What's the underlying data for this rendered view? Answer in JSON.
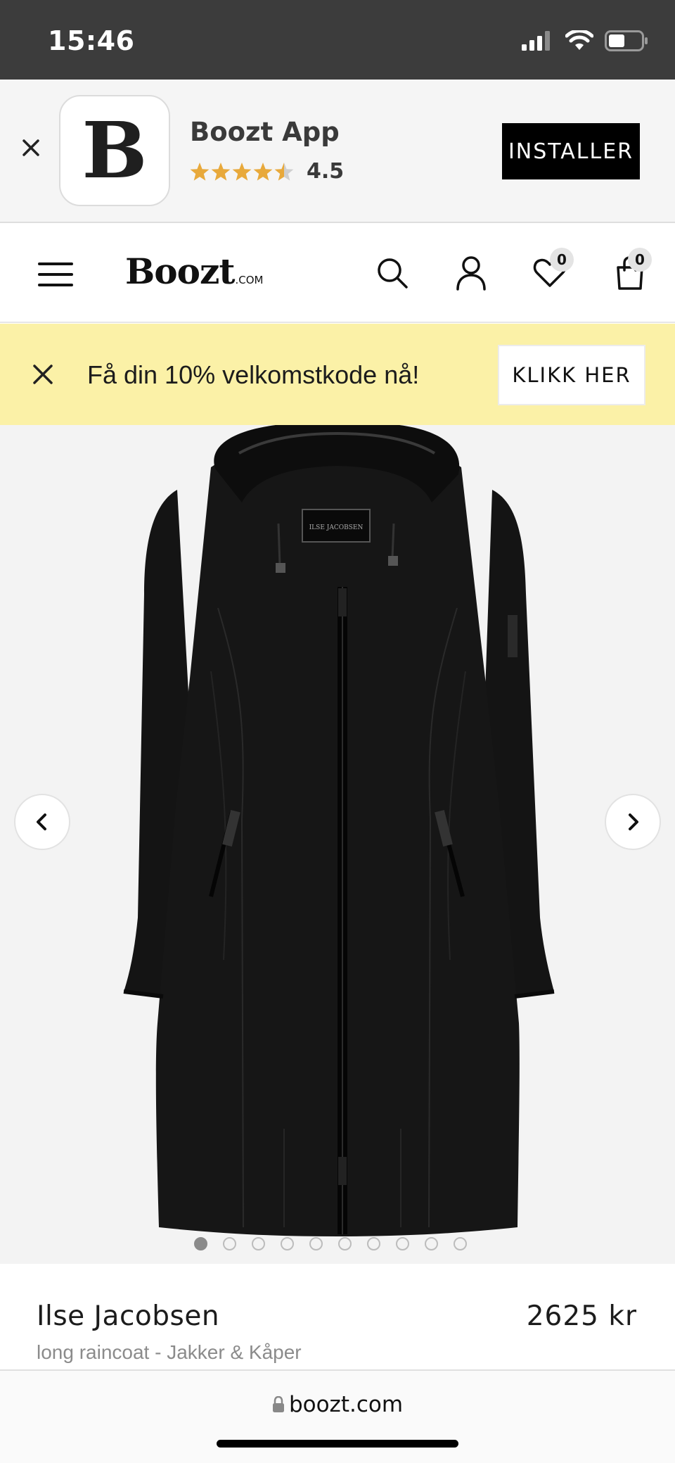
{
  "status_bar": {
    "time": "15:46"
  },
  "app_banner": {
    "icon_letter": "B",
    "app_name": "Boozt App",
    "rating": "4.5",
    "rating_value": 4.5,
    "install_label": "INSTALLER"
  },
  "header": {
    "logo": "Boozt",
    "logo_suffix": ".COM",
    "wishlist_count": "0",
    "cart_count": "0"
  },
  "promo": {
    "text": "Få din 10% velkomstkode nå!",
    "button_label": "KLIKK HER"
  },
  "product": {
    "coat_tag_brand": "ILSE JACOBSEN",
    "brand": "Ilse Jacobsen",
    "price": "2625 kr",
    "subtitle": "long raincoat - Jakker & Kåper",
    "image_count": 10,
    "active_image": 1
  },
  "browser": {
    "url": "boozt.com"
  },
  "colors": {
    "status_bar_bg": "#3c3c3c",
    "promo_bg": "#fbf1a7",
    "star_color": "#e8a93b",
    "install_bg": "#000000"
  }
}
